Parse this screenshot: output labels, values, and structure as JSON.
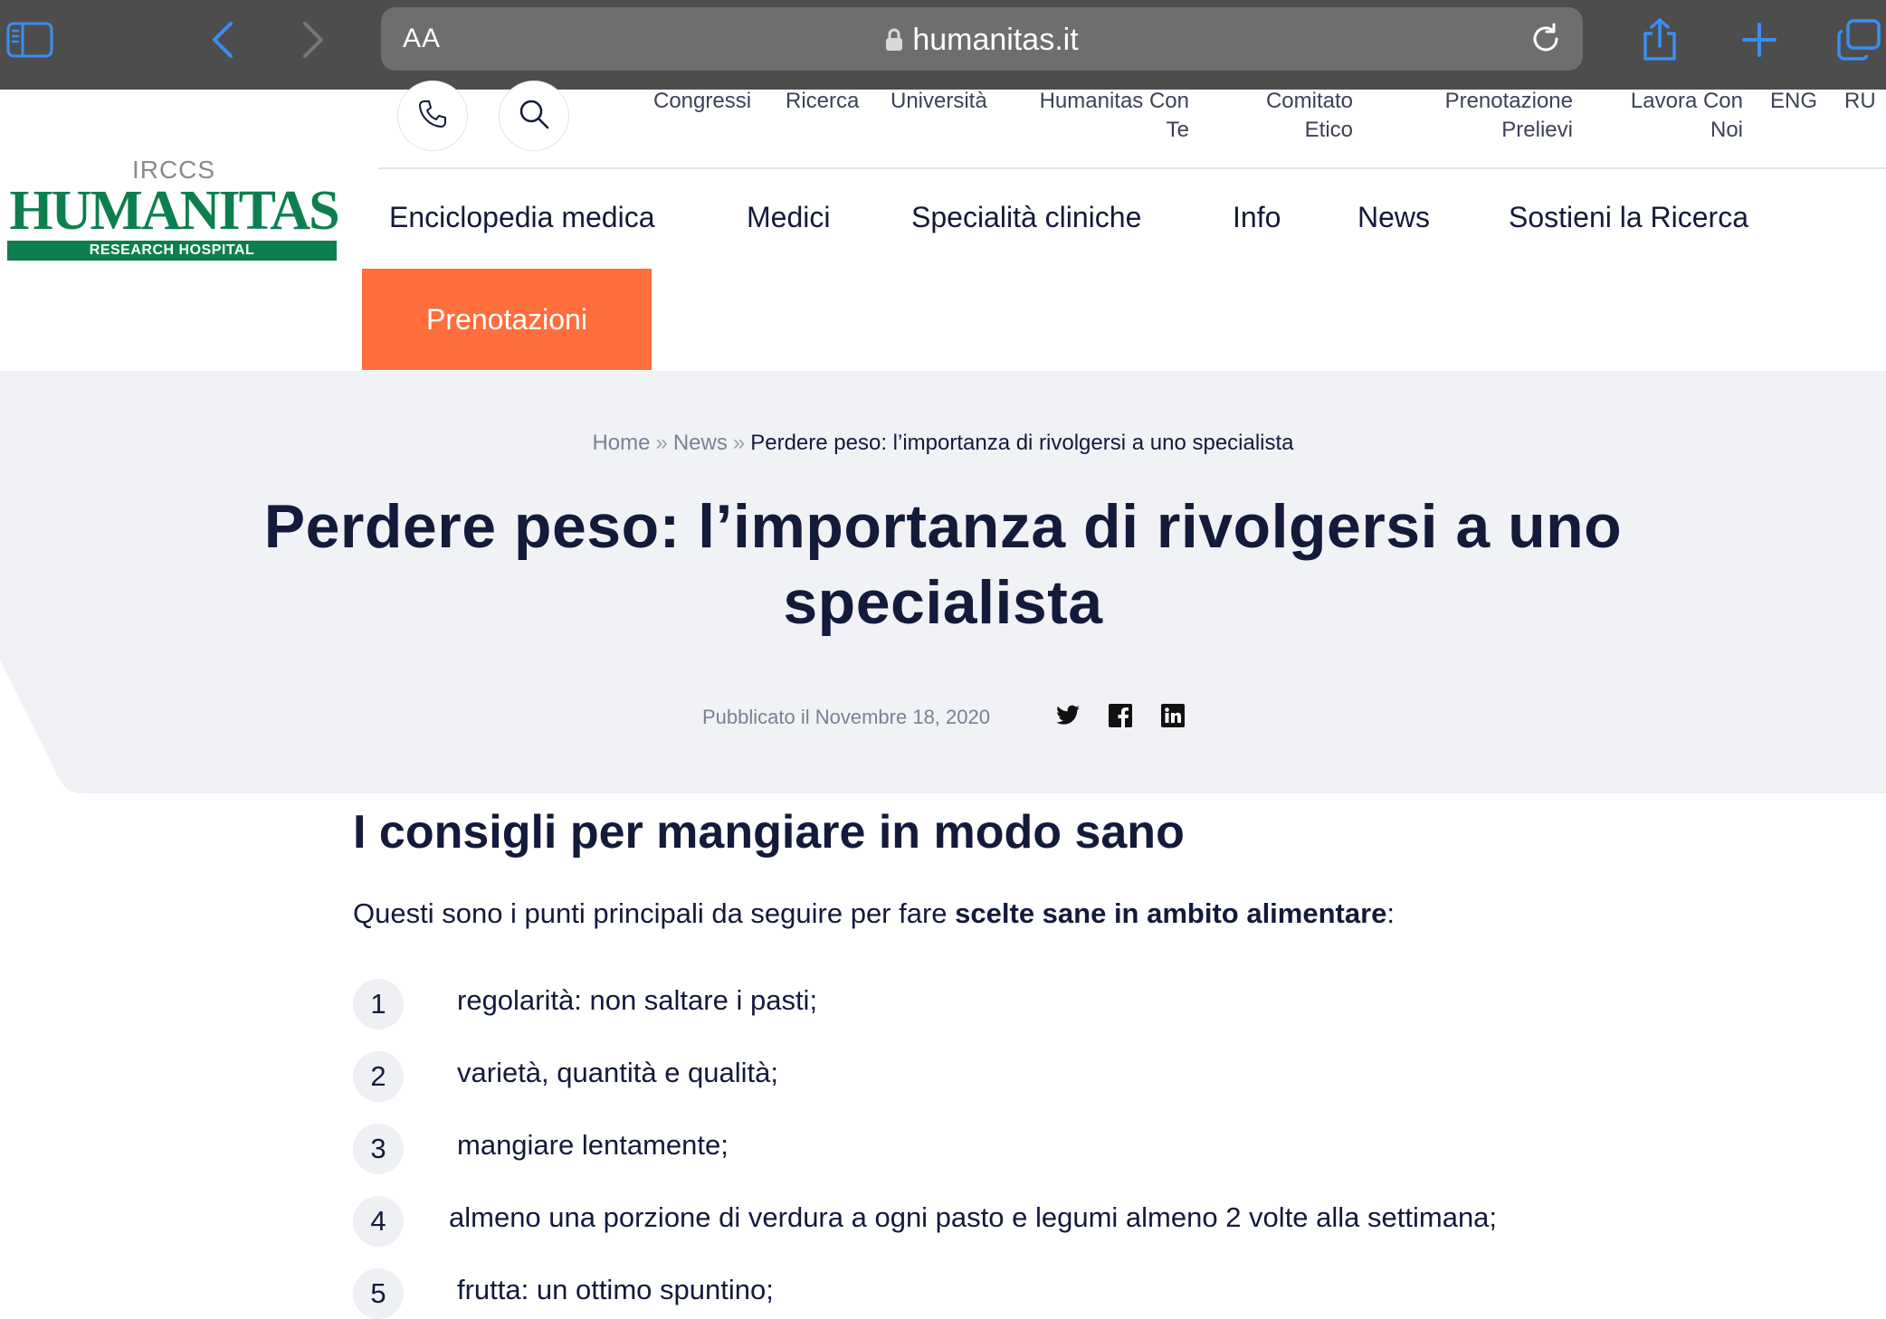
{
  "browser": {
    "text_size_label": "AA",
    "url": "humanitas.it"
  },
  "site": {
    "logo_top": "IRCCS",
    "logo_word": "HUMANITAS",
    "logo_sub": "RESEARCH HOSPITAL"
  },
  "top_links": [
    {
      "label": "Congressi"
    },
    {
      "label": "Ricerca"
    },
    {
      "label": "Università"
    },
    {
      "label": "Humanitas Con Te"
    },
    {
      "label": "Comitato Etico"
    },
    {
      "label": "Prenotazione Prelievi"
    },
    {
      "label": "Lavora Con Noi"
    },
    {
      "label": "ENG"
    },
    {
      "label": "RU"
    }
  ],
  "main_nav": [
    {
      "label": "Enciclopedia medica"
    },
    {
      "label": "Medici"
    },
    {
      "label": "Specialità cliniche"
    },
    {
      "label": "Info"
    },
    {
      "label": "News"
    },
    {
      "label": "Sostieni la Ricerca"
    }
  ],
  "booking_button": "Prenotazioni",
  "breadcrumb": {
    "home": "Home",
    "section": "News",
    "current": "Perdere peso: l’importanza di rivolgersi a uno specialista",
    "separator": "»"
  },
  "article": {
    "title": "Perdere peso: l’importanza di rivolgersi a uno specialista",
    "published": "Pubblicato il Novembre 18, 2020",
    "section_heading": "I consigli per mangiare in modo sano",
    "intro_before": "Questi sono i punti principali da seguire per fare ",
    "intro_bold": "scelte sane in ambito alimentare",
    "intro_after": ":",
    "list": [
      {
        "num": "1",
        "text": "regolarità: non saltare i pasti;"
      },
      {
        "num": "2",
        "text": "varietà, quantità e qualità;"
      },
      {
        "num": "3",
        "text": "mangiare lentamente;"
      },
      {
        "num": "4",
        "text": "almeno una porzione di verdura a ogni pasto e legumi almeno 2 volte alla settimana;"
      },
      {
        "num": "5",
        "text": "frutta: un ottimo spuntino;"
      }
    ]
  },
  "colors": {
    "browser_chrome": "#4d4d4d",
    "accent_blue": "#3b8ef0",
    "brand_green": "#0d7f4e",
    "booking_orange": "#ff6e3d",
    "hero_bg": "#f1f2f6",
    "text_dark": "#131a3a"
  },
  "icons": {
    "sidebar": "sidebar-icon",
    "back": "chevron-left-icon",
    "forward": "chevron-right-icon",
    "lock": "lock-icon",
    "reload": "reload-icon",
    "share": "share-icon",
    "new_tab": "plus-icon",
    "tabs": "tabs-icon",
    "phone": "phone-icon",
    "search": "search-icon",
    "twitter": "twitter-icon",
    "facebook": "facebook-icon",
    "linkedin": "linkedin-icon"
  }
}
